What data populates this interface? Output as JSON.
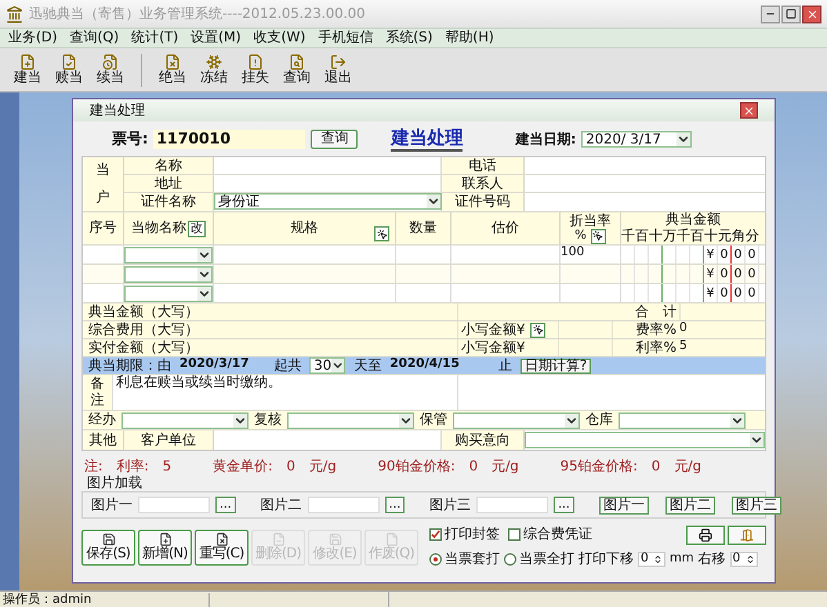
{
  "app": {
    "title": "迅驰典当（寄售）业务管理系统----2012.05.23.00.00"
  },
  "menu": [
    "业务(D)",
    "查询(Q)",
    "统计(T)",
    "设置(M)",
    "收支(W)",
    "手机短信",
    "系统(S)",
    "帮助(H)"
  ],
  "toolbar": [
    [
      {
        "label": "建当"
      },
      {
        "label": "赎当"
      },
      {
        "label": "续当"
      }
    ],
    [
      {
        "label": "绝当"
      },
      {
        "label": "冻结"
      },
      {
        "label": "挂失"
      },
      {
        "label": "查询"
      },
      {
        "label": "退出"
      }
    ]
  ],
  "dialog": {
    "title": "建当处理",
    "ticket_label": "票号:",
    "ticket_value": "1170010",
    "query_button": "查询",
    "heading": "建当处理",
    "date_label": "建当日期:",
    "date_value": "2020/ 3/17"
  },
  "customer": {
    "side_label": [
      "当",
      "户"
    ],
    "rows": [
      {
        "label": "名称",
        "right_label": "电话",
        "kind": "text"
      },
      {
        "label": "地址",
        "right_label": "联系人",
        "kind": "text"
      },
      {
        "label": "证件名称",
        "right_label": "证件号码",
        "kind": "select",
        "value": "身份证"
      }
    ]
  },
  "items": {
    "columns": {
      "index": "序号",
      "name": "当物名称",
      "name_button": "改",
      "spec": "规格",
      "qty": "数量",
      "estimate": "估价",
      "rate": "折当率",
      "rate_unit": "%",
      "amount": "典当金额"
    },
    "digits": [
      "千",
      "百",
      "十",
      "万",
      "千",
      "百",
      "十",
      "元",
      "角",
      "分"
    ],
    "rows": [
      {
        "rate": "100",
        "amount": [
          "¥",
          "0",
          "0",
          "0"
        ]
      },
      {
        "amount": [
          "¥",
          "0",
          "0",
          "0"
        ]
      },
      {
        "amount": [
          "¥",
          "0",
          "0",
          "0"
        ]
      }
    ]
  },
  "totals": [
    {
      "label": "典当金额（大写）",
      "right_label": "合　计"
    },
    {
      "label": "综合费用（大写）",
      "small_label": "小写金额¥",
      "calc_button": true,
      "rate_label": "费率%",
      "rate_value": "0"
    },
    {
      "label": "实付金额（大写）",
      "small_label": "小写金额¥",
      "calc_button": false,
      "rate_label": "利率%",
      "rate_value": "5"
    }
  ],
  "period": {
    "label": "典当期限：由",
    "start": "2020/3/17",
    "days_label": "起共",
    "days": "30",
    "to_label": "天至",
    "end": "2020/4/15",
    "end_label": "止",
    "calc_button": "日期计算?"
  },
  "remarks": {
    "label": [
      "备",
      "注"
    ],
    "text": "利息在赎当或续当时缴纳。"
  },
  "staff": [
    {
      "label": "经办"
    },
    {
      "label": "复核"
    },
    {
      "label": "保管"
    },
    {
      "label": "仓库"
    }
  ],
  "other": {
    "label": "其他",
    "unit_label": "客户单位",
    "purchase_label": "购买意向"
  },
  "price_note": {
    "note": "注:",
    "items": [
      {
        "label": "利率:",
        "value": "5"
      },
      {
        "label": "黄金单价:",
        "value": "0",
        "unit": "元/g"
      },
      {
        "label": "90铂金价格:",
        "value": "0",
        "unit": "元/g"
      },
      {
        "label": "95铂金价格:",
        "value": "0",
        "unit": "元/g"
      }
    ]
  },
  "images": {
    "title": "图片加载",
    "slots": [
      "图片一",
      "图片二",
      "图片三"
    ],
    "browse_button": "...",
    "view_buttons": [
      "图片一",
      "图片二",
      "图片三"
    ]
  },
  "actions": [
    {
      "label": "保存(S)",
      "disabled": false
    },
    {
      "label": "新增(N)",
      "disabled": false
    },
    {
      "label": "重写(C)",
      "disabled": false
    },
    {
      "label": "删除(D)",
      "disabled": true
    },
    {
      "label": "修改(E)",
      "disabled": true
    },
    {
      "label": "作废(Q)",
      "disabled": true
    }
  ],
  "print": {
    "checkboxes": [
      {
        "label": "打印封签",
        "checked": true
      },
      {
        "label": "综合费凭证",
        "checked": false
      }
    ],
    "modes": [
      {
        "label": "当票套打",
        "selected": true
      },
      {
        "label": "当票全打",
        "selected": false
      }
    ],
    "down_label": "打印下移",
    "down_value": "0",
    "unit": "mm",
    "right_label": "右移",
    "right_value": "0"
  },
  "status_bar": {
    "operator": "操作员：admin"
  }
}
